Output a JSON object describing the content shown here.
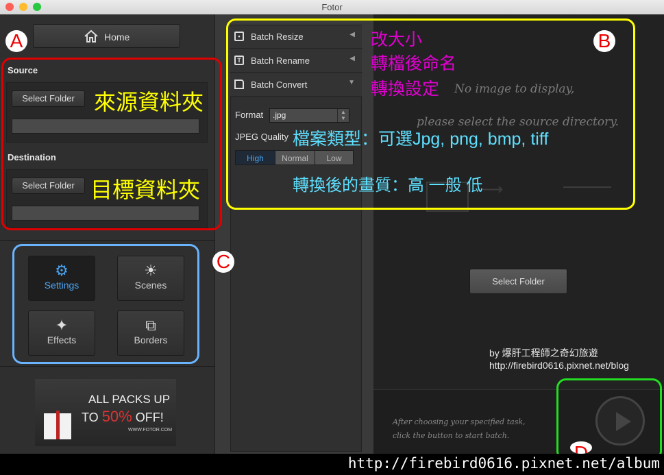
{
  "window": {
    "title": "Fotor"
  },
  "sidebar": {
    "home_label": "Home",
    "source_label": "Source",
    "source_button": "Select Folder",
    "destination_label": "Destination",
    "destination_button": "Select Folder",
    "tools": [
      {
        "label": "Settings",
        "icon": "gear-icon",
        "active": true
      },
      {
        "label": "Scenes",
        "icon": "sun-icon",
        "active": false
      },
      {
        "label": "Effects",
        "icon": "sparkle-icon",
        "active": false
      },
      {
        "label": "Borders",
        "icon": "borders-icon",
        "active": false
      }
    ],
    "ad": {
      "line1": "ALL PACKS UP",
      "line2_pre": "TO",
      "line2_pct": "50%",
      "line2_post": "OFF!",
      "site": "WWW.FOTOR.COM"
    }
  },
  "settings_panel": {
    "menu": [
      {
        "label": "Batch Resize",
        "icon": "resize-icon",
        "arrow": "◀"
      },
      {
        "label": "Batch Rename",
        "icon": "rename-icon",
        "arrow": "◀"
      },
      {
        "label": "Batch Convert",
        "icon": "document-icon",
        "arrow": "▼"
      }
    ],
    "format_label": "Format",
    "format_value": ".jpg",
    "quality_label": "JPEG Quality",
    "quality_options": [
      "High",
      "Normal",
      "Low"
    ],
    "quality_selected": "High"
  },
  "preview": {
    "empty_line1": "No image to display,",
    "empty_line2": "please select the source directory.",
    "select_button": "Select Folder",
    "hint_line1": "After choosing your specified task,",
    "hint_line2": "click the button to start batch."
  },
  "annotations": {
    "letters": [
      "A",
      "B",
      "C",
      "D"
    ],
    "source_note": "來源資料夾",
    "dest_note": "目標資料夾",
    "resize_note": "改大小",
    "rename_note": "轉檔後命名",
    "convert_note": "轉換設定",
    "format_note": "檔案類型：可選Jpg, png, bmp, tiff",
    "quality_note": "轉換後的畫質：高 一般 低",
    "credit_line1": "by 爆肝工程師之奇幻旅遊",
    "credit_line2": "http://firebird0616.pixnet.net/blog",
    "watermark": "http://firebird0616.pixnet.net/album"
  },
  "colors": {
    "accent_blue": "#4aa3f0",
    "ann_red": "#e00000",
    "ann_yellow": "#ffff00",
    "ann_blue": "#6ab4ff",
    "ann_green": "#22dd22",
    "ann_magenta": "#e000d0",
    "ann_cyan": "#5ee0ff"
  }
}
